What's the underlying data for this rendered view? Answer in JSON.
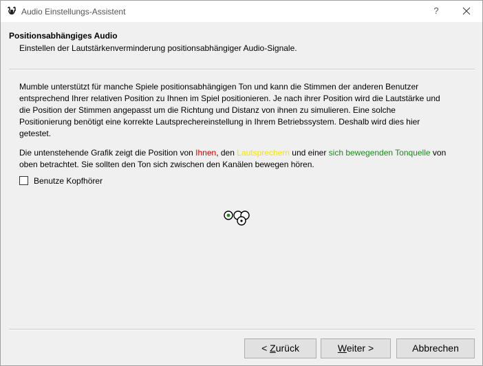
{
  "window": {
    "title": "Audio Einstellungs-Assistent",
    "help_label": "?"
  },
  "header": {
    "title": "Positionsabhängiges Audio",
    "subtitle": "Einstellen der Lautstärkenverminderung positionsabhängiger Audio-Signale."
  },
  "content": {
    "paragraph1": "Mumble unterstützt für manche Spiele positionsabhängigen Ton und kann die Stimmen der anderen Benutzer entsprechend Ihrer relativen Position zu Ihnen im Spiel positionieren. Je nach ihrer Position wird die Lautstärke und die Position der Stimmen angepasst um die Richtung und Distanz von ihnen zu simulieren. Eine solche Positionierung benötigt eine korrekte Lautsprechereinstellung in Ihrem Betriebssystem. Deshalb wird dies hier getestet.",
    "paragraph2_part1": "Die untenstehende Grafik zeigt die Position von ",
    "paragraph2_you": "Ihnen",
    "paragraph2_part2": ", den ",
    "paragraph2_speakers": "Lautsprechern",
    "paragraph2_part3": " und einer ",
    "paragraph2_source": "sich bewegenden Tonquelle",
    "paragraph2_part4": " von oben betrachtet. Sie sollten den Ton sich zwischen den Kanälen bewegen hören.",
    "headphones_label": "Benutze Kopfhörer",
    "headphones_checked": false
  },
  "colors": {
    "you": "#cc0000",
    "speakers": "#f4e400",
    "source": "#1a8a1a"
  },
  "buttons": {
    "back": "< Zurück",
    "back_mnemonic": "Z",
    "next": "Weiter >",
    "next_mnemonic": "W",
    "cancel": "Abbrechen"
  }
}
